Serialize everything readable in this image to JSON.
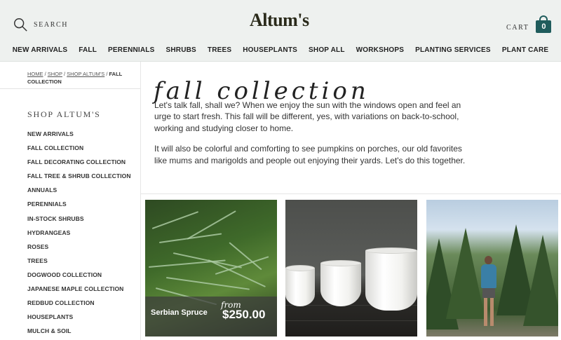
{
  "header": {
    "search_label": "SEARCH",
    "logo_text": "Altum's",
    "cart_label": "CART",
    "cart_count": "0"
  },
  "nav": [
    {
      "label": "NEW ARRIVALS"
    },
    {
      "label": "FALL"
    },
    {
      "label": "PERENNIALS"
    },
    {
      "label": "SHRUBS"
    },
    {
      "label": "TREES"
    },
    {
      "label": "HOUSEPLANTS"
    },
    {
      "label": "SHOP ALL"
    },
    {
      "label": "WORKSHOPS"
    },
    {
      "label": "PLANTING SERVICES"
    },
    {
      "label": "PLANT CARE"
    }
  ],
  "breadcrumb": {
    "home": "HOME",
    "shop": "SHOP",
    "shop_altums": "SHOP ALTUM'S",
    "current": "FALL COLLECTION"
  },
  "sidebar": {
    "title": "SHOP ALTUM'S",
    "items": [
      {
        "label": "NEW ARRIVALS"
      },
      {
        "label": "FALL COLLECTION"
      },
      {
        "label": "FALL DECORATING COLLECTION"
      },
      {
        "label": "FALL TREE & SHRUB COLLECTION"
      },
      {
        "label": "ANNUALS"
      },
      {
        "label": "PERENNIALS"
      },
      {
        "label": "IN-STOCK SHRUBS"
      },
      {
        "label": "HYDRANGEAS"
      },
      {
        "label": "ROSES"
      },
      {
        "label": "TREES"
      },
      {
        "label": "DOGWOOD COLLECTION"
      },
      {
        "label": "JAPANESE MAPLE COLLECTION"
      },
      {
        "label": "REDBUD COLLECTION"
      },
      {
        "label": "HOUSEPLANTS"
      },
      {
        "label": "MULCH & SOIL"
      }
    ]
  },
  "main": {
    "title": "fall collection",
    "paragraph1": "Let's talk fall, shall we? When we enjoy the sun with the windows open and feel an urge to start fresh. This fall will be different, yes, with variations on back-to-school, working and studying closer to home.",
    "paragraph2": "It will also be colorful and comforting to see pumpkins on porches, our old favorites like mums and marigolds and people out enjoying their yards. Let's do this together."
  },
  "products": [
    {
      "name": "Serbian Spruce",
      "from_label": "from",
      "price": "$250.00"
    }
  ],
  "colors": {
    "header_bg": "#eef1ef",
    "cart_badge": "#1f5c5c"
  }
}
